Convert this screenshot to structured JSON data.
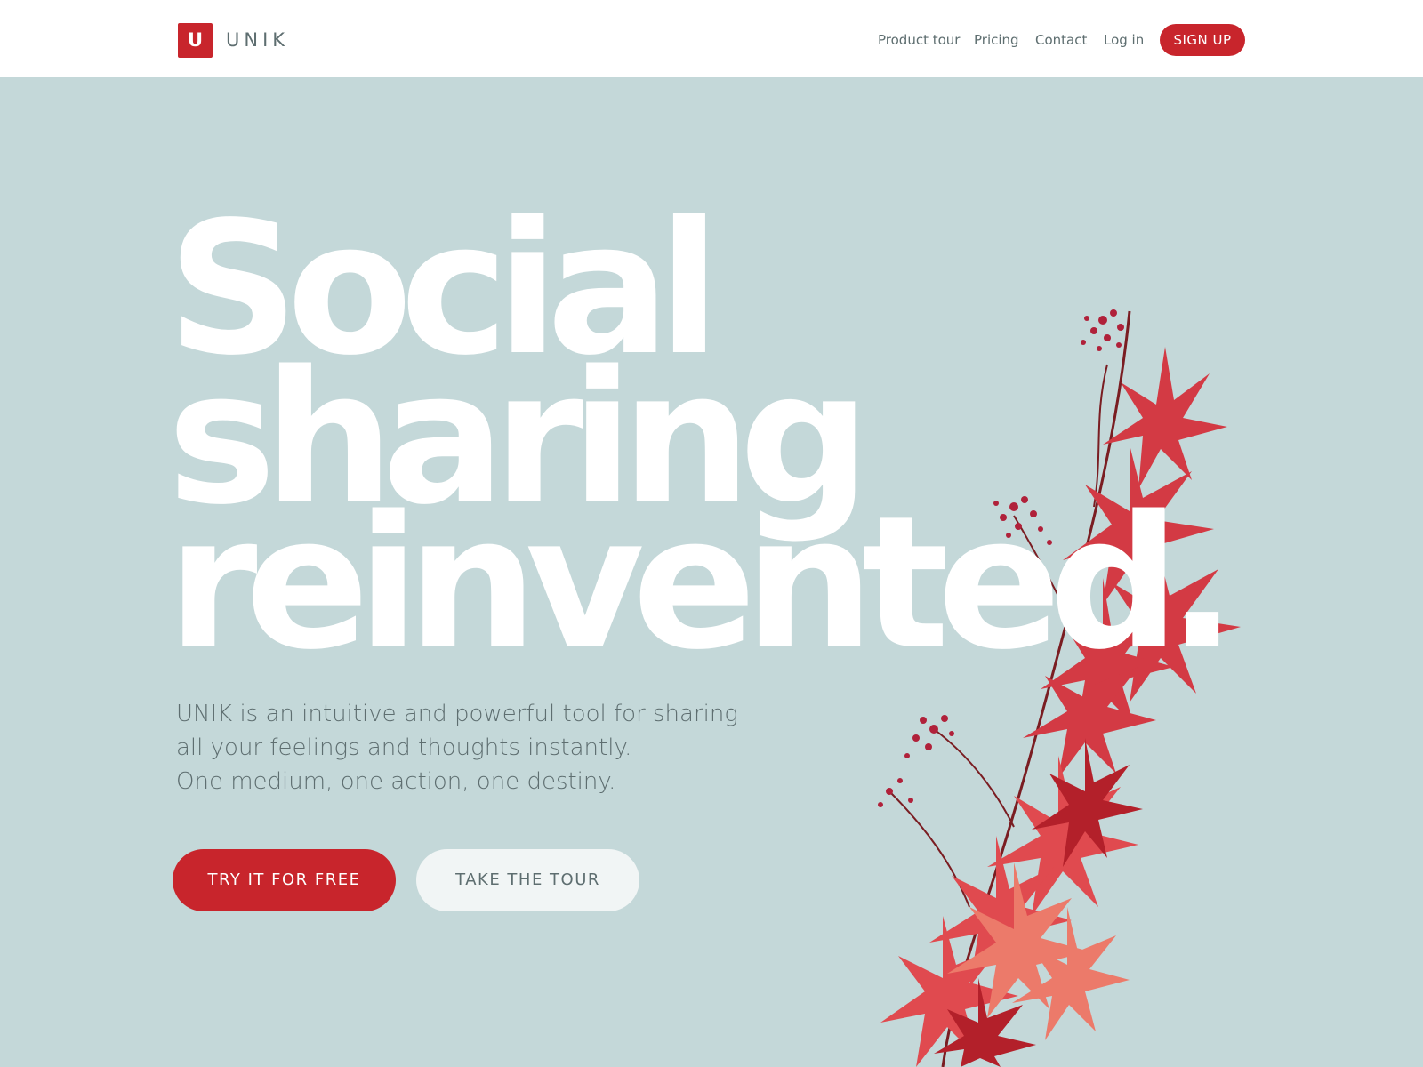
{
  "header": {
    "logo_letter": "U",
    "brand": "UNIK",
    "nav": [
      "Product tour",
      "Pricing",
      "Contact",
      "Log in"
    ],
    "signup_label": "SIGN UP"
  },
  "hero": {
    "headline": [
      "Social",
      "sharing",
      "reinvented."
    ],
    "subtitle": [
      "UNIK is an intuitive and powerful tool for sharing",
      "all your feelings and thoughts instantly.",
      "One medium, one action, one destiny."
    ],
    "primary_cta": "TRY IT FOR FREE",
    "secondary_cta": "TAKE THE TOUR"
  },
  "colors": {
    "background": "#c4d8d9",
    "accent": "#c8252c",
    "text_muted": "#5e6e70",
    "white": "#ffffff"
  }
}
